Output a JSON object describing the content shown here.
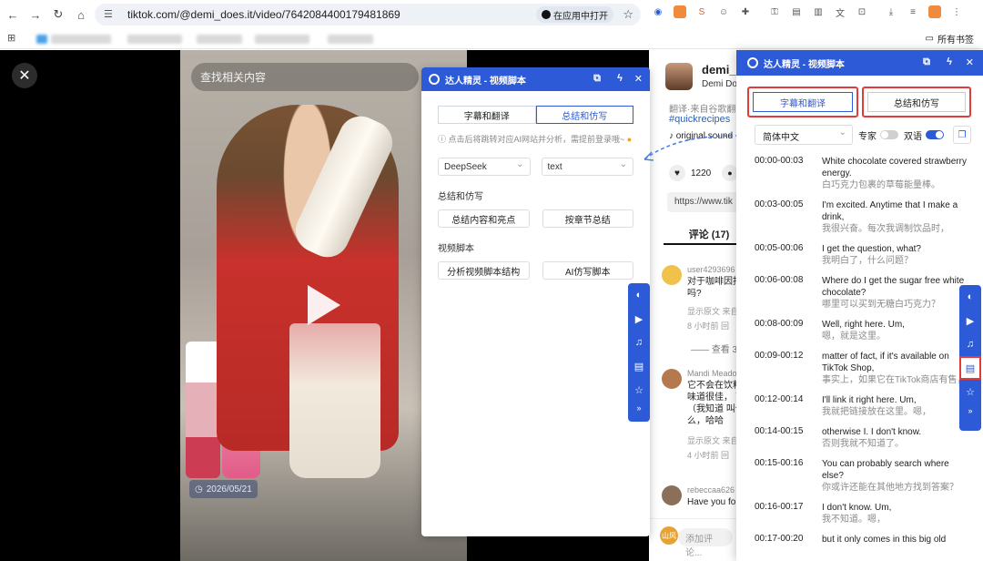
{
  "browser": {
    "url": "tiktok.com/@demi_does.it/video/7642084400179481869",
    "open_in_app": "在应用中打开",
    "bookmarks_folder": "所有书签"
  },
  "video": {
    "search_placeholder": "查找相关内容",
    "date": "2026/05/21"
  },
  "info": {
    "author": "demi_c",
    "author_sub": "Demi Doe",
    "translated_note": "翻译·来自谷歌翻译",
    "hashtag": "#quickrecipes",
    "sound": "original sound",
    "likes": "1220",
    "link": "https://www.tik",
    "comments_tab": "评论 (17)",
    "comments": [
      {
        "user": "user4293696",
        "text": "对于咖啡因拍 吾吗?",
        "meta1": "显示原文 来自",
        "meta2": "8 小时前 回"
      },
      {
        "user": "Mandi Meado",
        "text": "它不会在饮料 里味道很佳， 了！（我知道 叫什么，哈哈",
        "meta1": "显示原文 来自",
        "meta2": "4 小时前 回"
      },
      {
        "user": "rebeccaa626",
        "text": "Have you fo",
        "meta1": "",
        "meta2": ""
      }
    ],
    "view_more": "—— 查看 3",
    "add_comment_avatar": "山风",
    "add_comment_placeholder": "添加评论..."
  },
  "panel1": {
    "title": "达人精灵 - 视频脚本",
    "tab_subs": "字幕和翻译",
    "tab_summary": "总结和仿写",
    "hint": "点击后将跳转对应AI网站并分析，需提前登录哦~",
    "model": "DeepSeek",
    "format": "text",
    "sec_summary": "总结和仿写",
    "btn_summary_highlights": "总结内容和亮点",
    "btn_chapter_summary": "按章节总结",
    "sec_script": "视频脚本",
    "btn_analyze_structure": "分析视频脚本结构",
    "btn_ai_rewrite": "AI仿写脚本"
  },
  "panel2": {
    "title": "达人精灵 - 视频脚本",
    "tab_subs": "字幕和翻译",
    "tab_summary": "总结和仿写",
    "language": "简体中文",
    "expert_label": "专家",
    "bilingual_label": "双语",
    "subtitles": [
      {
        "time": "00:00-00:03",
        "en": "White chocolate covered strawberry",
        "en2": "energy.",
        "zh": "白巧克力包裹的草莓能量棒。"
      },
      {
        "time": "00:03-00:05",
        "en": "I'm excited. Anytime that I make a",
        "en2": "drink,",
        "zh": "我很兴奋。每次我调制饮品时，"
      },
      {
        "time": "00:05-00:06",
        "en": "I get the question, what?",
        "en2": "",
        "zh": "我明白了，什么问题？"
      },
      {
        "time": "00:06-00:08",
        "en": "Where do I get the sugar free white",
        "en2": "chocolate?",
        "zh": "哪里可以买到无糖白巧克力？"
      },
      {
        "time": "00:08-00:09",
        "en": "Well, right here. Um,",
        "en2": "",
        "zh": "嗯，就是这里。"
      },
      {
        "time": "00:09-00:12",
        "en": "matter of fact, if it's available on",
        "en2": "TikTok Shop,",
        "zh": "事实上，如果它在TikTok商店有售，"
      },
      {
        "time": "00:12-00:14",
        "en": "I'll link it right here. Um,",
        "en2": "",
        "zh": "我就把链接放在这里。嗯，"
      },
      {
        "time": "00:14-00:15",
        "en": "otherwise I. I don't know.",
        "en2": "",
        "zh": "否则我就不知道了。"
      },
      {
        "time": "00:15-00:16",
        "en": "You can probably search where",
        "en2": "else?",
        "zh": "你或许还能在其他地方找到答案？"
      },
      {
        "time": "00:16-00:17",
        "en": "I don't know. Um,",
        "en2": "",
        "zh": "我不知道。嗯，"
      },
      {
        "time": "00:17-00:20",
        "en": "but it only comes in this big old",
        "en2": "",
        "zh": ""
      }
    ]
  },
  "colors": {
    "plugin_blue": "#2d5bd8",
    "highlight_red": "#e03c3c"
  }
}
